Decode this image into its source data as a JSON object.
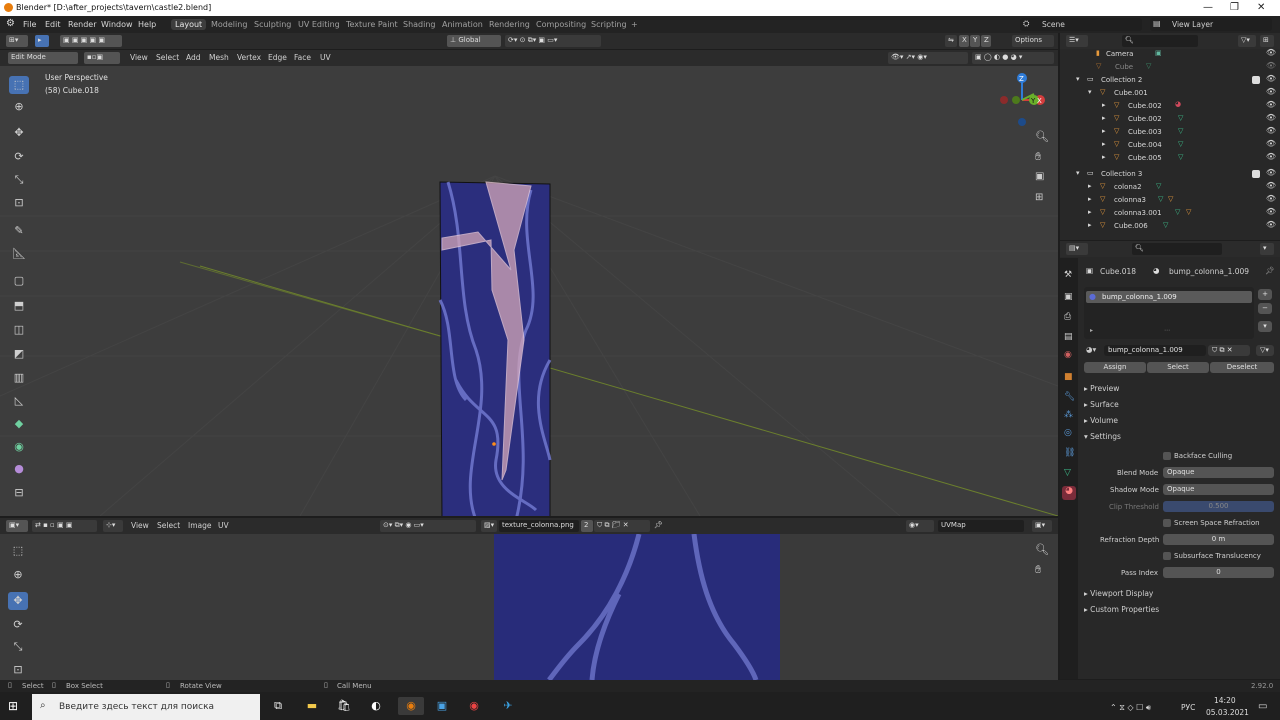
{
  "window": {
    "title": "Blender* [D:\\after_projects\\tavern\\castle2.blend]",
    "minimize": "—",
    "maximize": "❐",
    "close": "✕"
  },
  "menu": {
    "items": [
      "File",
      "Edit",
      "Render",
      "Window",
      "Help"
    ],
    "workspaces": [
      "Layout",
      "Modeling",
      "Sculpting",
      "UV Editing",
      "Texture Paint",
      "Shading",
      "Animation",
      "Rendering",
      "Compositing",
      "Scripting"
    ],
    "active_workspace": "Layout",
    "add_workspace": "+",
    "scene": "Scene",
    "view_layer": "View Layer"
  },
  "viewport_header": {
    "transform_orientation": "Global",
    "axes": [
      "X",
      "Y",
      "Z"
    ],
    "options": "Options",
    "mode": "Edit Mode",
    "menus": [
      "View",
      "Select",
      "Add",
      "Mesh",
      "Vertex",
      "Edge",
      "Face",
      "UV"
    ]
  },
  "viewport": {
    "perspective": "User Perspective",
    "object_info": "(58) Cube.018",
    "gizmo_labels": {
      "x": "X",
      "y": "Y",
      "z": "Z"
    }
  },
  "uv_header": {
    "menus": [
      "View",
      "Select",
      "Image",
      "UV"
    ],
    "image_name": "texture_colonna.png",
    "users": "2",
    "uvmap": "UVMap"
  },
  "outliner": {
    "search_placeholder": "",
    "rows": [
      {
        "name": "Camera",
        "indent": 1,
        "kind": "camera"
      },
      {
        "name": "Cube",
        "indent": 1,
        "kind": "mesh-dim"
      },
      {
        "name": "Collection 2",
        "indent": 0,
        "kind": "collection"
      },
      {
        "name": "Cube.001",
        "indent": 1,
        "kind": "mesh"
      },
      {
        "name": "Cube.002",
        "indent": 2,
        "kind": "mesh"
      },
      {
        "name": "Cube.002",
        "indent": 1,
        "kind": "mesh"
      },
      {
        "name": "Cube.003",
        "indent": 1,
        "kind": "mesh"
      },
      {
        "name": "Cube.004",
        "indent": 1,
        "kind": "mesh"
      },
      {
        "name": "Cube.005",
        "indent": 1,
        "kind": "mesh"
      },
      {
        "name": "Collection 3",
        "indent": 0,
        "kind": "collection"
      },
      {
        "name": "colona2",
        "indent": 1,
        "kind": "mesh"
      },
      {
        "name": "colonna3",
        "indent": 1,
        "kind": "mesh"
      },
      {
        "name": "colonna3.001",
        "indent": 1,
        "kind": "mesh"
      },
      {
        "name": "Cube.006",
        "indent": 1,
        "kind": "mesh"
      }
    ]
  },
  "properties": {
    "object": "Cube.018",
    "material": "bump_colonna_1.009",
    "slot": "bump_colonna_1.009",
    "material_field": "bump_colonna_1.009",
    "assign": "Assign",
    "select": "Select",
    "deselect": "Deselect",
    "panels": [
      "Preview",
      "Surface",
      "Volume",
      "Settings"
    ],
    "backface_culling": "Backface Culling",
    "blend_mode_label": "Blend Mode",
    "blend_mode": "Opaque",
    "shadow_mode_label": "Shadow Mode",
    "shadow_mode": "Opaque",
    "clip_threshold_label": "Clip Threshold",
    "clip_threshold": "0.500",
    "screen_space_refraction": "Screen Space Refraction",
    "refraction_depth_label": "Refraction Depth",
    "refraction_depth": "0 m",
    "subsurface_translucency": "Subsurface Translucency",
    "pass_index_label": "Pass Index",
    "pass_index": "0",
    "viewport_display": "Viewport Display",
    "custom_properties": "Custom Properties"
  },
  "statusbar": {
    "select": "Select",
    "box_select": "Box Select",
    "rotate_view": "Rotate View",
    "call_menu": "Call Menu",
    "version": "2.92.0"
  },
  "taskbar": {
    "search_placeholder": "Введите здесь текст для поиска",
    "lang": "РУС",
    "time": "14:20",
    "date": "05.03.2021"
  },
  "colors": {
    "accent": "#4772b3",
    "texture_blue": "#2a2d7a",
    "vein": "#6f74c8"
  }
}
